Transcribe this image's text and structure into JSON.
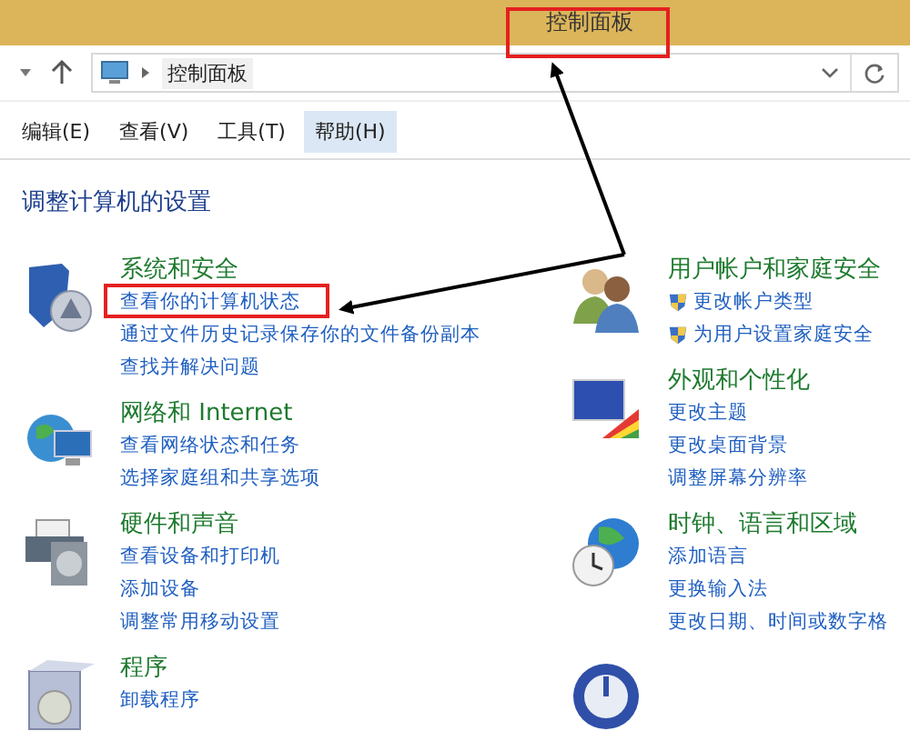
{
  "window": {
    "title": "控制面板"
  },
  "address_bar": {
    "path": "控制面板"
  },
  "menu": [
    {
      "label": "编辑(E)",
      "selected": false
    },
    {
      "label": "查看(V)",
      "selected": false
    },
    {
      "label": "工具(T)",
      "selected": false
    },
    {
      "label": "帮助(H)",
      "selected": true
    }
  ],
  "heading": "调整计算机的设置",
  "left_categories": [
    {
      "kind": "security",
      "title": "系统和安全",
      "links": [
        {
          "text": "查看你的计算机状态",
          "kind": "plain"
        },
        {
          "text": "通过文件历史记录保存你的文件备份副本",
          "kind": "plain"
        },
        {
          "text": "查找并解决问题",
          "kind": "plain"
        }
      ]
    },
    {
      "kind": "network",
      "title": "网络和 Internet",
      "links": [
        {
          "text": "查看网络状态和任务",
          "kind": "plain"
        },
        {
          "text": "选择家庭组和共享选项",
          "kind": "plain"
        }
      ]
    },
    {
      "kind": "hardware",
      "title": "硬件和声音",
      "links": [
        {
          "text": "查看设备和打印机",
          "kind": "plain"
        },
        {
          "text": "添加设备",
          "kind": "plain"
        },
        {
          "text": "调整常用移动设置",
          "kind": "plain"
        }
      ]
    },
    {
      "kind": "programs",
      "title": "程序",
      "links": [
        {
          "text": "卸载程序",
          "kind": "plain"
        }
      ]
    }
  ],
  "right_categories": [
    {
      "kind": "users",
      "title": "用户帐户和家庭安全",
      "links": [
        {
          "text": "更改帐户类型",
          "kind": "shield"
        },
        {
          "text": "为用户设置家庭安全",
          "kind": "shield"
        }
      ]
    },
    {
      "kind": "appearance",
      "title": "外观和个性化",
      "links": [
        {
          "text": "更改主题",
          "kind": "plain"
        },
        {
          "text": "更改桌面背景",
          "kind": "plain"
        },
        {
          "text": "调整屏幕分辨率",
          "kind": "plain"
        }
      ]
    },
    {
      "kind": "clock",
      "title": "时钟、语言和区域",
      "links": [
        {
          "text": "添加语言",
          "kind": "plain"
        },
        {
          "text": "更换输入法",
          "kind": "plain"
        },
        {
          "text": "更改日期、时间或数字格",
          "kind": "plain"
        }
      ]
    },
    {
      "kind": "ease"
    }
  ]
}
